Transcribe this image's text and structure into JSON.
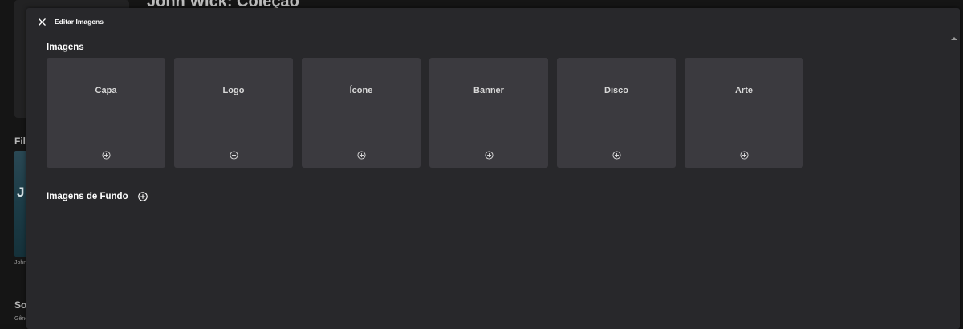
{
  "background": {
    "title": "John Wick: Coleção",
    "section_films": "Film",
    "poster_letter": "J",
    "poster_caption": "John",
    "section_about": "Sob",
    "genres_label": "Gêne"
  },
  "modal": {
    "title": "Editar Imagens",
    "images_section": "Imagens",
    "tiles": [
      {
        "label": "Capa"
      },
      {
        "label": "Logo"
      },
      {
        "label": "Ícone"
      },
      {
        "label": "Banner"
      },
      {
        "label": "Disco"
      },
      {
        "label": "Arte"
      }
    ],
    "backdrops_section": "Imagens de Fundo"
  },
  "colors": {
    "modal_bg": "#28282b",
    "tile_bg": "#3b3a3f",
    "text": "#ffffff"
  }
}
